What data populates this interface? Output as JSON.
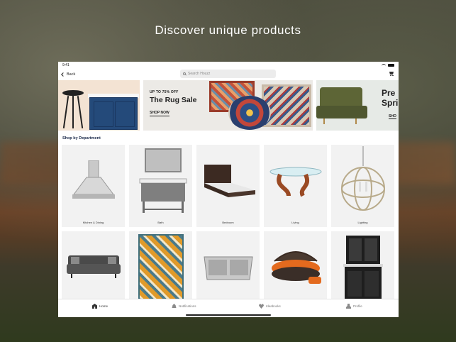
{
  "headline": "Discover unique products",
  "status": {
    "time": "9:41"
  },
  "nav": {
    "back_label": "Back",
    "search_placeholder": "Search Houzz"
  },
  "banners": [
    {
      "id": "furniture"
    },
    {
      "eyebrow": "UP TO 75% OFF",
      "title": "The Rug Sale",
      "cta": "SHOP NOW"
    },
    {
      "title_line1": "Pre",
      "title_line2": "Sprin",
      "cta": "SHO"
    }
  ],
  "section_title": "Shop by Department",
  "departments": [
    {
      "label": "Kitchen & Dining",
      "icon": "range-hood"
    },
    {
      "label": "Bath",
      "icon": "bath-vanity"
    },
    {
      "label": "Bedroom",
      "icon": "bed"
    },
    {
      "label": "Living",
      "icon": "coffee-table"
    },
    {
      "label": "Lighting",
      "icon": "orb-chandelier"
    },
    {
      "label": "",
      "icon": "sofa"
    },
    {
      "label": "",
      "icon": "patterned-rug"
    },
    {
      "label": "",
      "icon": "kitchen-sink"
    },
    {
      "label": "",
      "icon": "outdoor-daybed"
    },
    {
      "label": "",
      "icon": "buffet-hutch"
    }
  ],
  "tabs": [
    {
      "label": "Home",
      "icon": "home-icon",
      "active": true
    },
    {
      "label": "Notifications",
      "icon": "bell-icon",
      "active": false
    },
    {
      "label": "Ideabooks",
      "icon": "heart-icon",
      "active": false
    },
    {
      "label": "Profile",
      "icon": "profile-icon",
      "active": false
    }
  ],
  "colors": {
    "accent_navy": "#1b2a4a",
    "tile_bg": "#f2f2f2"
  }
}
